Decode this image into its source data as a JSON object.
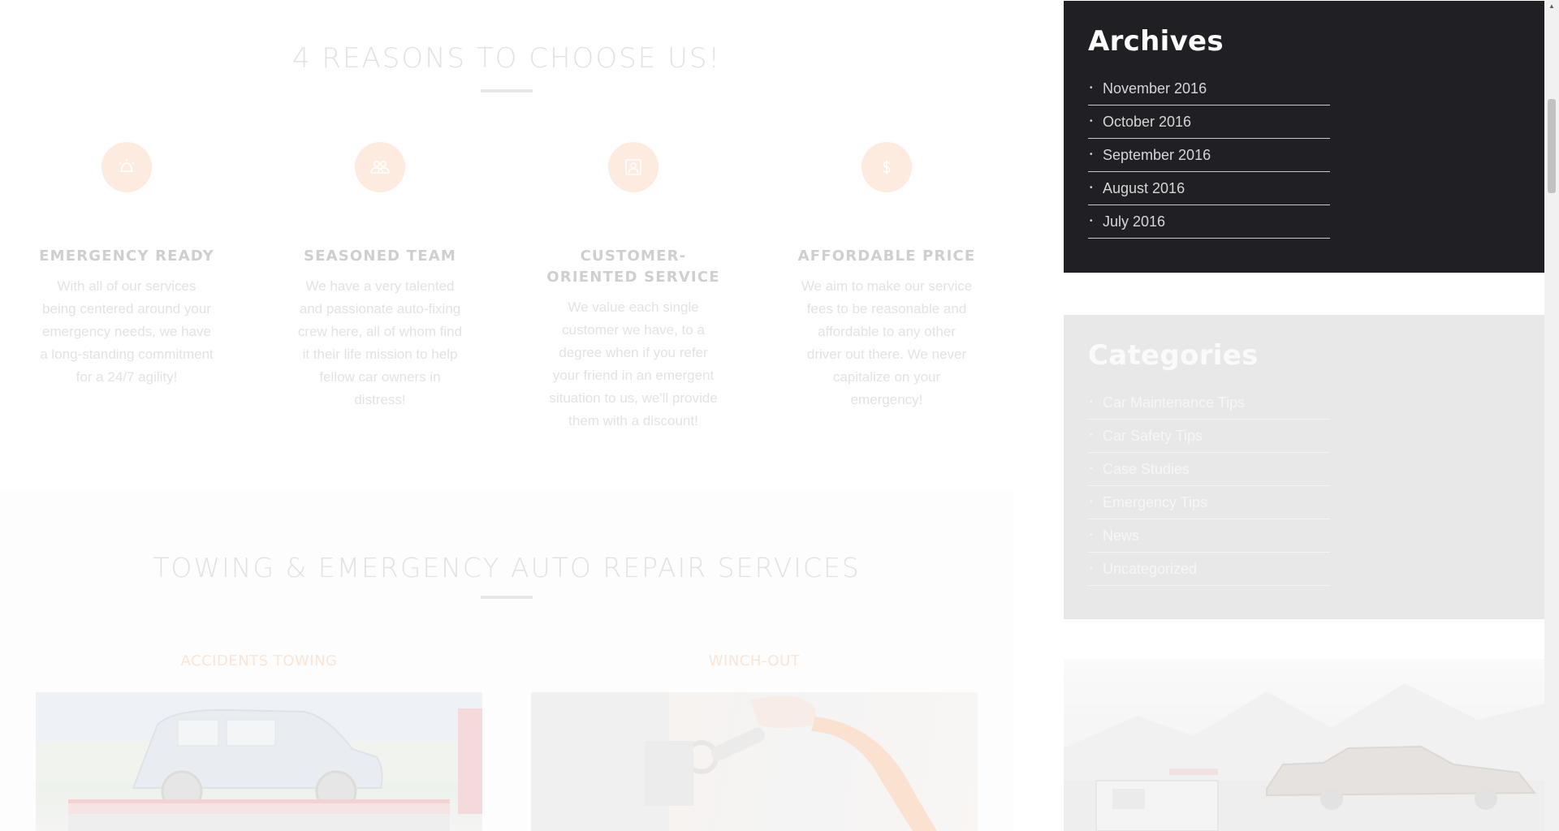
{
  "reasons": {
    "title": "4 REASONS TO CHOOSE US!",
    "items": [
      {
        "icon": "alarm-bell-icon",
        "title": "EMERGENCY READY",
        "text": "With all of our services being centered around your emergency needs, we have a long-standing commitment for a 24/7 agility!"
      },
      {
        "icon": "team-icon",
        "title": "SEASONED TEAM",
        "text": "We have a very talented and passionate auto-fixing crew here, all of whom find it their life mission to help fellow car owners in distress!"
      },
      {
        "icon": "customer-profile-icon",
        "title": "CUSTOMER-ORIENTED SERVICE",
        "text": "We value each single customer we have, to a degree when if you refer your friend in an emergent situation to us, we'll provide them with a discount!"
      },
      {
        "icon": "dollar-icon",
        "title": "AFFORDABLE PRICE",
        "text": "We aim to make our service fees to be reasonable and affordable to any other driver out there. We never capitalize on your emergency!"
      }
    ]
  },
  "services": {
    "title": "TOWING & EMERGENCY AUTO REPAIR SERVICES",
    "items": [
      {
        "label": "ACCIDENTS TOWING"
      },
      {
        "label": "WINCH-OUT"
      }
    ]
  },
  "sidebar": {
    "archives": {
      "title": "Archives",
      "items": [
        "November 2016",
        "October 2016",
        "September 2016",
        "August 2016",
        "July 2016"
      ]
    },
    "categories": {
      "title": "Categories",
      "items": [
        "Car Maintenance Tips",
        "Car Safety Tips",
        "Case Studies",
        "Emergency Tips",
        "News",
        "Uncategorized"
      ]
    }
  },
  "colors": {
    "accent": "#fdebe0",
    "archives_bg": "#202024",
    "categories_bg": "#e8e8e8"
  }
}
